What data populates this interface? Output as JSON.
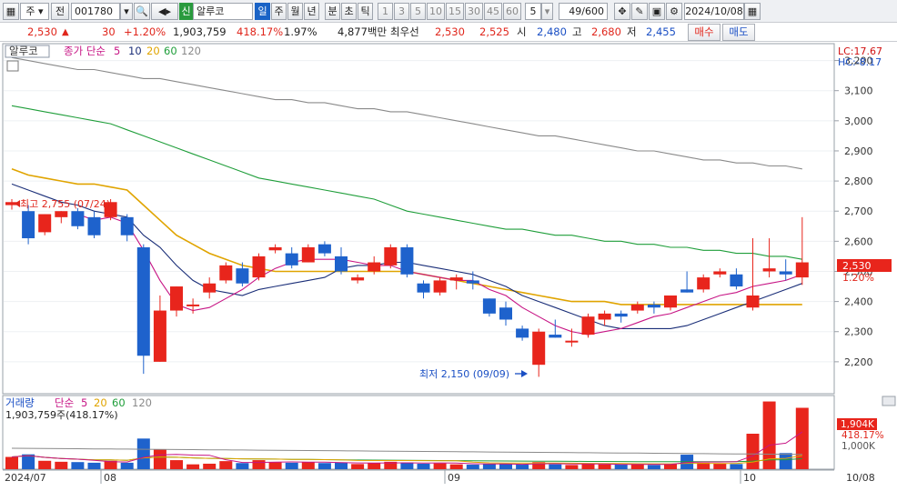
{
  "toolbar": {
    "market": "주",
    "label_all": "전",
    "code": "001780",
    "badge": "신",
    "name": "알루코",
    "periods": [
      "일",
      "주",
      "월",
      "년",
      "분",
      "초",
      "틱"
    ],
    "intervals": [
      "1",
      "3",
      "5",
      "10",
      "15",
      "30",
      "45",
      "60"
    ],
    "interval_value": "5",
    "count": "49/600",
    "date": "2024/10/08"
  },
  "quote": {
    "price": "2,530",
    "change_arrow": "▲",
    "change": "30",
    "change_pct": "+1.20%",
    "volume": "1,903,759",
    "volume_ratio": "418.17%",
    "turnover": "1.97%",
    "amount": "4,877백만",
    "best_label": "최우선",
    "ask": "2,530",
    "bid": "2,525",
    "open_label": "시",
    "open": "2,480",
    "high_label": "고",
    "high": "2,680",
    "low_label": "저",
    "low": "2,455",
    "buy": "매수",
    "sell": "매도"
  },
  "price_panel": {
    "title": "알루코",
    "ma_label": "종가 단순",
    "ma_periods": [
      "5",
      "10",
      "20",
      "60",
      "120"
    ],
    "lc": "LC:17.67",
    "hc": "HC:-8.17",
    "high_marker": "최고 2,755 (07/24)",
    "low_marker": "최저 2,150 (09/09)",
    "last_price": "2,530",
    "last_pct": "1.20%"
  },
  "volume_panel": {
    "title": "거래량",
    "ma_label": "단순",
    "ma_periods": [
      "5",
      "20",
      "60",
      "120"
    ],
    "summary": "1,903,759주(418.17%)",
    "last_value": "1,904K",
    "last_pct": "418.17%",
    "ref_label": "1,000K"
  },
  "x_axis": {
    "labels": [
      "2024/07",
      "08",
      "09",
      "10",
      "10/08"
    ]
  },
  "colors": {
    "up": "#e8251c",
    "down": "#1e62cc",
    "ma5": "#c71585",
    "ma10": "#1a2e78",
    "ma20": "#e0a400",
    "ma60": "#1f9e3a",
    "ma120": "#8a8a8a"
  },
  "chart_data": {
    "type": "candlestick",
    "ylim": [
      2100,
      3250
    ],
    "yticks": [
      2200,
      2300,
      2400,
      2500,
      2600,
      2700,
      2800,
      2900,
      3000,
      3100,
      3200
    ],
    "volume_max": 2200000,
    "candles": [
      {
        "o": 2720,
        "h": 2740,
        "l": 2705,
        "c": 2730,
        "v": 380000
      },
      {
        "o": 2700,
        "h": 2720,
        "l": 2590,
        "c": 2610,
        "v": 460000
      },
      {
        "o": 2630,
        "h": 2690,
        "l": 2620,
        "c": 2690,
        "v": 260000
      },
      {
        "o": 2680,
        "h": 2700,
        "l": 2660,
        "c": 2700,
        "v": 230000
      },
      {
        "o": 2700,
        "h": 2710,
        "l": 2640,
        "c": 2650,
        "v": 220000
      },
      {
        "o": 2680,
        "h": 2700,
        "l": 2610,
        "c": 2620,
        "v": 200000
      },
      {
        "o": 2680,
        "h": 2740,
        "l": 2670,
        "c": 2730,
        "v": 260000
      },
      {
        "o": 2680,
        "h": 2690,
        "l": 2600,
        "c": 2620,
        "v": 200000
      },
      {
        "o": 2580,
        "h": 2590,
        "l": 2160,
        "c": 2220,
        "v": 950000
      },
      {
        "o": 2200,
        "h": 2420,
        "l": 2200,
        "c": 2370,
        "v": 610000
      },
      {
        "o": 2370,
        "h": 2450,
        "l": 2350,
        "c": 2450,
        "v": 280000
      },
      {
        "o": 2390,
        "h": 2410,
        "l": 2360,
        "c": 2390,
        "v": 150000
      },
      {
        "o": 2430,
        "h": 2480,
        "l": 2410,
        "c": 2460,
        "v": 170000
      },
      {
        "o": 2470,
        "h": 2530,
        "l": 2460,
        "c": 2520,
        "v": 250000
      },
      {
        "o": 2510,
        "h": 2530,
        "l": 2450,
        "c": 2460,
        "v": 190000
      },
      {
        "o": 2480,
        "h": 2560,
        "l": 2470,
        "c": 2550,
        "v": 280000
      },
      {
        "o": 2570,
        "h": 2590,
        "l": 2560,
        "c": 2580,
        "v": 210000
      },
      {
        "o": 2560,
        "h": 2580,
        "l": 2510,
        "c": 2520,
        "v": 200000
      },
      {
        "o": 2530,
        "h": 2590,
        "l": 2530,
        "c": 2580,
        "v": 220000
      },
      {
        "o": 2590,
        "h": 2600,
        "l": 2550,
        "c": 2560,
        "v": 190000
      },
      {
        "o": 2550,
        "h": 2580,
        "l": 2490,
        "c": 2500,
        "v": 200000
      },
      {
        "o": 2470,
        "h": 2490,
        "l": 2460,
        "c": 2480,
        "v": 160000
      },
      {
        "o": 2500,
        "h": 2550,
        "l": 2490,
        "c": 2530,
        "v": 190000
      },
      {
        "o": 2520,
        "h": 2590,
        "l": 2510,
        "c": 2580,
        "v": 230000
      },
      {
        "o": 2580,
        "h": 2590,
        "l": 2480,
        "c": 2490,
        "v": 210000
      },
      {
        "o": 2460,
        "h": 2470,
        "l": 2410,
        "c": 2430,
        "v": 170000
      },
      {
        "o": 2430,
        "h": 2480,
        "l": 2420,
        "c": 2470,
        "v": 180000
      },
      {
        "o": 2470,
        "h": 2490,
        "l": 2440,
        "c": 2480,
        "v": 150000
      },
      {
        "o": 2470,
        "h": 2500,
        "l": 2440,
        "c": 2460,
        "v": 140000
      },
      {
        "o": 2410,
        "h": 2410,
        "l": 2350,
        "c": 2360,
        "v": 160000
      },
      {
        "o": 2380,
        "h": 2400,
        "l": 2320,
        "c": 2340,
        "v": 170000
      },
      {
        "o": 2310,
        "h": 2320,
        "l": 2270,
        "c": 2280,
        "v": 140000
      },
      {
        "o": 2190,
        "h": 2310,
        "l": 2150,
        "c": 2300,
        "v": 220000
      },
      {
        "o": 2290,
        "h": 2340,
        "l": 2280,
        "c": 2280,
        "v": 150000
      },
      {
        "o": 2270,
        "h": 2310,
        "l": 2250,
        "c": 2270,
        "v": 130000
      },
      {
        "o": 2290,
        "h": 2360,
        "l": 2280,
        "c": 2350,
        "v": 170000
      },
      {
        "o": 2340,
        "h": 2370,
        "l": 2320,
        "c": 2360,
        "v": 150000
      },
      {
        "o": 2360,
        "h": 2370,
        "l": 2330,
        "c": 2350,
        "v": 140000
      },
      {
        "o": 2370,
        "h": 2400,
        "l": 2360,
        "c": 2390,
        "v": 160000
      },
      {
        "o": 2390,
        "h": 2400,
        "l": 2360,
        "c": 2380,
        "v": 130000
      },
      {
        "o": 2380,
        "h": 2420,
        "l": 2370,
        "c": 2420,
        "v": 170000
      },
      {
        "o": 2440,
        "h": 2500,
        "l": 2430,
        "c": 2430,
        "v": 450000
      },
      {
        "o": 2440,
        "h": 2490,
        "l": 2430,
        "c": 2480,
        "v": 200000
      },
      {
        "o": 2490,
        "h": 2510,
        "l": 2480,
        "c": 2500,
        "v": 170000
      },
      {
        "o": 2490,
        "h": 2510,
        "l": 2440,
        "c": 2450,
        "v": 160000
      },
      {
        "o": 2380,
        "h": 2610,
        "l": 2370,
        "c": 2420,
        "v": 1100000
      },
      {
        "o": 2500,
        "h": 2610,
        "l": 2480,
        "c": 2510,
        "v": 2100000
      },
      {
        "o": 2500,
        "h": 2540,
        "l": 2470,
        "c": 2490,
        "v": 500000
      },
      {
        "o": 2480,
        "h": 2680,
        "l": 2455,
        "c": 2530,
        "v": 1903759
      }
    ],
    "ma5": [
      null,
      null,
      null,
      null,
      2690,
      2670,
      2680,
      2660,
      2570,
      2470,
      2390,
      2370,
      2380,
      2410,
      2440,
      2480,
      2510,
      2530,
      2540,
      2540,
      2540,
      2530,
      2520,
      2520,
      2500,
      2490,
      2480,
      2470,
      2470,
      2440,
      2420,
      2380,
      2350,
      2320,
      2300,
      2290,
      2300,
      2310,
      2330,
      2350,
      2360,
      2380,
      2400,
      2420,
      2430,
      2450,
      2460,
      2470,
      2490
    ],
    "ma10": [
      2790,
      2770,
      2750,
      2730,
      2720,
      2700,
      2690,
      2680,
      2620,
      2580,
      2520,
      2470,
      2440,
      2430,
      2420,
      2440,
      2450,
      2460,
      2470,
      2480,
      2510,
      2520,
      2520,
      2530,
      2530,
      2520,
      2510,
      2500,
      2490,
      2470,
      2450,
      2420,
      2400,
      2380,
      2360,
      2340,
      2320,
      2310,
      2310,
      2310,
      2310,
      2320,
      2340,
      2360,
      2380,
      2400,
      2420,
      2440,
      2460
    ],
    "ma20": [
      2840,
      2820,
      2810,
      2800,
      2790,
      2790,
      2780,
      2770,
      2720,
      2670,
      2620,
      2590,
      2560,
      2540,
      2520,
      2510,
      2500,
      2500,
      2500,
      2500,
      2500,
      2500,
      2500,
      2500,
      2500,
      2490,
      2480,
      2470,
      2460,
      2450,
      2440,
      2430,
      2420,
      2410,
      2400,
      2400,
      2400,
      2390,
      2390,
      2390,
      2390,
      2390,
      2390,
      2390,
      2390,
      2390,
      2390,
      2390,
      2390
    ],
    "ma60": [
      3050,
      3040,
      3030,
      3020,
      3010,
      3000,
      2990,
      2970,
      2950,
      2930,
      2910,
      2890,
      2870,
      2850,
      2830,
      2810,
      2800,
      2790,
      2780,
      2770,
      2760,
      2750,
      2740,
      2720,
      2700,
      2690,
      2680,
      2670,
      2660,
      2650,
      2640,
      2640,
      2630,
      2620,
      2620,
      2610,
      2600,
      2600,
      2590,
      2590,
      2580,
      2580,
      2570,
      2570,
      2560,
      2560,
      2550,
      2550,
      2540
    ],
    "ma120": [
      3210,
      3200,
      3190,
      3180,
      3170,
      3170,
      3160,
      3150,
      3140,
      3140,
      3130,
      3120,
      3110,
      3100,
      3090,
      3080,
      3070,
      3070,
      3060,
      3060,
      3050,
      3040,
      3040,
      3030,
      3030,
      3020,
      3010,
      3000,
      2990,
      2980,
      2970,
      2960,
      2950,
      2950,
      2940,
      2930,
      2920,
      2910,
      2900,
      2900,
      2890,
      2880,
      2870,
      2870,
      2860,
      2860,
      2850,
      2850,
      2840
    ]
  }
}
